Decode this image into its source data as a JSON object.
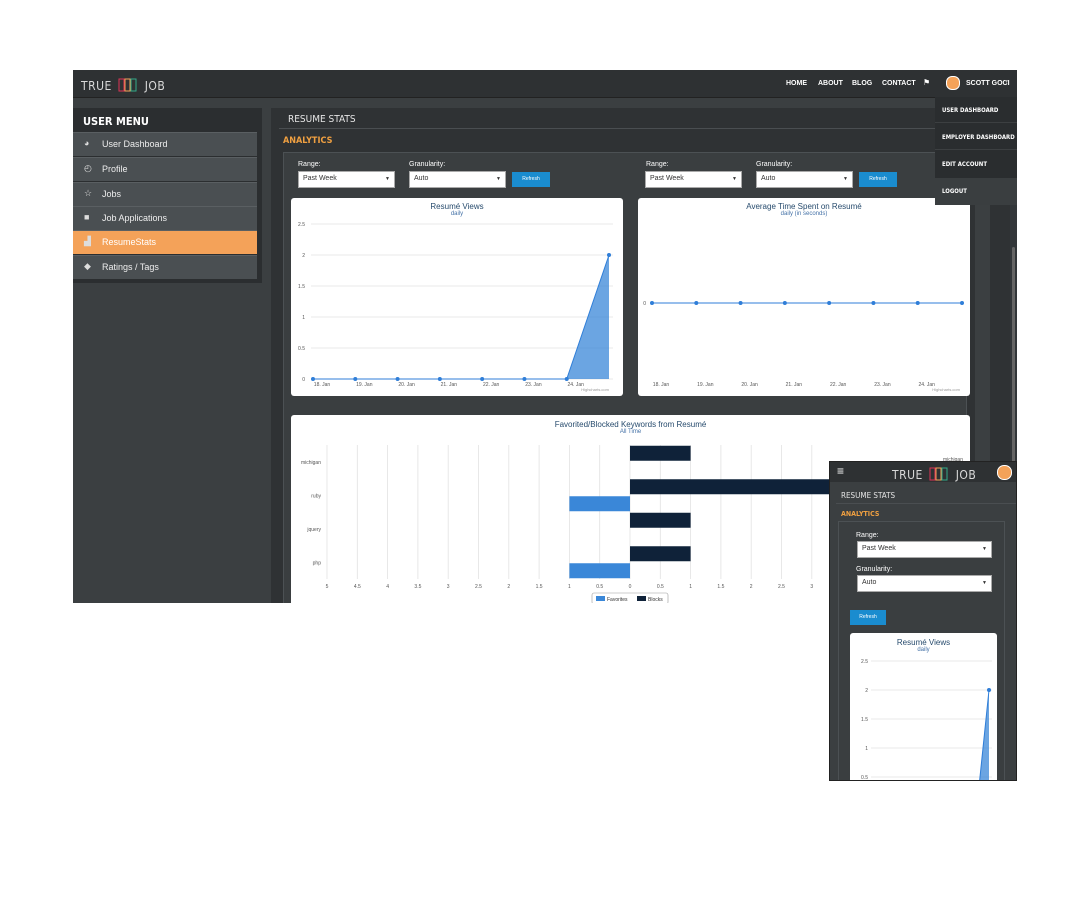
{
  "brand": {
    "left": "TRUE",
    "right": "JOB"
  },
  "nav": {
    "home": "HOME",
    "about": "ABOUT",
    "blog": "BLOG",
    "contact": "CONTACT",
    "user": "SCOTT GOCI"
  },
  "user_menu": {
    "items": [
      "USER DASHBOARD",
      "EMPLOYER DASHBOARD",
      "EDIT ACCOUNT",
      "LOGOUT"
    ]
  },
  "sidebar": {
    "title": "USER MENU",
    "items": [
      {
        "label": "User Dashboard",
        "icon": "dashboard-icon"
      },
      {
        "label": "Profile",
        "icon": "user-circle-icon"
      },
      {
        "label": "Jobs",
        "icon": "star-icon"
      },
      {
        "label": "Job Applications",
        "icon": "briefcase-icon"
      },
      {
        "label": "ResumeStats",
        "icon": "area-chart-icon",
        "active": true
      },
      {
        "label": "Ratings / Tags",
        "icon": "tags-icon"
      }
    ]
  },
  "page": {
    "section": "RESUME STATS",
    "analytics": "ANALYTICS"
  },
  "controls": {
    "range_label": "Range:",
    "granularity_label": "Granularity:",
    "range_value": "Past Week",
    "granularity_value": "Auto",
    "refresh": "Refresh"
  },
  "colors": {
    "accent": "#f4a259",
    "primary": "#1a8ccf",
    "series_blue": "#3a87d8",
    "series_dark": "#0f2239"
  },
  "chart_data": [
    {
      "type": "area",
      "title": "Resumé Views",
      "subtitle": "daily",
      "credit": "Highcharts.com",
      "x": [
        "18. Jan",
        "19. Jan",
        "20. Jan",
        "21. Jan",
        "22. Jan",
        "23. Jan",
        "24. Jan",
        ""
      ],
      "values": [
        0,
        0,
        0,
        0,
        0,
        0,
        0,
        2
      ],
      "yticks": [
        "0",
        "0.5",
        "1",
        "1.5",
        "2",
        "2.5"
      ],
      "ylim": [
        0,
        2.5
      ]
    },
    {
      "type": "line",
      "title": "Average Time Spent on Resumé",
      "subtitle": "daily (in seconds)",
      "credit": "Highcharts.com",
      "x": [
        "18. Jan",
        "19. Jan",
        "20. Jan",
        "21. Jan",
        "22. Jan",
        "23. Jan",
        "24. Jan",
        ""
      ],
      "values": [
        0,
        0,
        0,
        0,
        0,
        0,
        0,
        0
      ],
      "yticks": [
        "0"
      ]
    },
    {
      "type": "bar",
      "title": "Favorited/Blocked Keywords from Resumé",
      "subtitle": "All Time",
      "categories": [
        "michigan",
        "ruby",
        "jquery",
        "php"
      ],
      "series": [
        {
          "name": "Favorites",
          "values": [
            0,
            1,
            0,
            1
          ]
        },
        {
          "name": "Blocks",
          "values": [
            1,
            5,
            1,
            1
          ]
        }
      ],
      "xticks": [
        "5",
        "4.5",
        "4",
        "3.5",
        "3",
        "2.5",
        "2",
        "1.5",
        "1",
        "0.5",
        "0",
        "0.5",
        "1",
        "1.5",
        "2",
        "2.5",
        "3"
      ],
      "legend": "bottom"
    }
  ],
  "mobile": {
    "section": "RESUME STATS",
    "analytics": "ANALYTICS",
    "chart": {
      "title": "Resumé Views",
      "subtitle": "daily",
      "yticks": [
        "2.5",
        "2",
        "1.5",
        "1",
        "0.5"
      ]
    }
  }
}
